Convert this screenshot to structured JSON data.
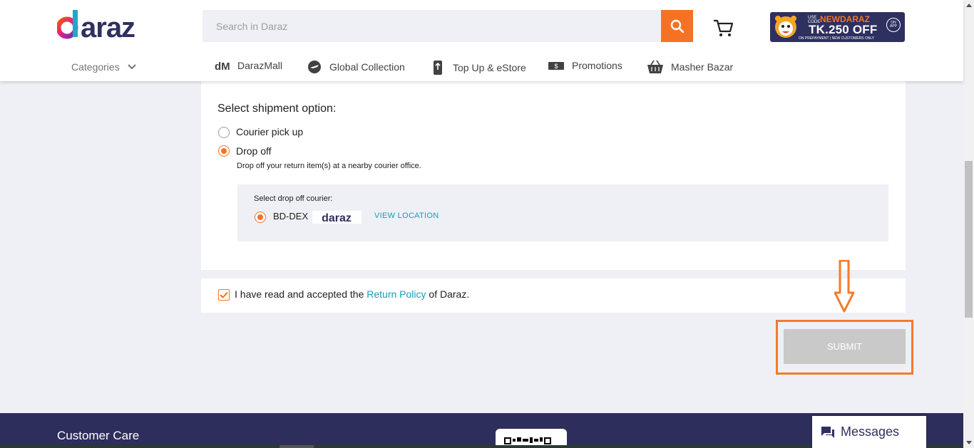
{
  "header": {
    "logo_text": "daraz",
    "search": {
      "placeholder": "Search in Daraz",
      "value": ""
    },
    "promo": {
      "small_text": "USE CODE",
      "code": "NEWDARAZ",
      "amount": "TK.250 OFF",
      "footnote": "ON PREPAYMENT | NEW CUSTOMERS ONLY",
      "badge": "ON APP"
    },
    "categories_label": "Categories",
    "nav": [
      {
        "label": "DarazMall",
        "icon": "darazmall-icon"
      },
      {
        "label": "Global Collection",
        "icon": "airplane-icon"
      },
      {
        "label": "Top Up & eStore",
        "icon": "mobile-topup-icon"
      },
      {
        "label": "Promotions",
        "icon": "promotions-icon"
      },
      {
        "label": "Masher Bazar",
        "icon": "basket-icon"
      }
    ]
  },
  "shipment": {
    "title": "Select shipment option:",
    "options": [
      {
        "label": "Courier pick up",
        "selected": false
      },
      {
        "label": "Drop off",
        "selected": true
      }
    ],
    "dropoff_desc": "Drop off your return item(s) at a nearby courier office.",
    "courier": {
      "title": "Select drop off courier:",
      "name": "BD-DEX",
      "logo_text": "daraz",
      "view_location": "VIEW LOCATION",
      "selected": true
    }
  },
  "policy": {
    "prefix": "I have read and accepted the ",
    "link": "Return Policy",
    "suffix": " of Daraz.",
    "checked": true
  },
  "submit_label": "SUBMIT",
  "footer": {
    "customer_care": "Customer Care",
    "messages": "Messages"
  },
  "colors": {
    "accent": "#f57224",
    "link": "#1a9cb7",
    "footer_bg": "#2e2e5c",
    "submit_disabled": "#c9c9c9"
  }
}
